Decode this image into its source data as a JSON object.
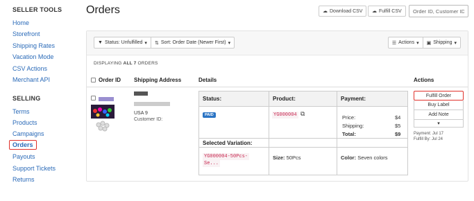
{
  "sidebar": {
    "seller_tools_heading": "SELLER TOOLS",
    "seller_tools": [
      "Home",
      "Storefront",
      "Shipping Rates",
      "Vacation Mode",
      "CSV Actions",
      "Merchant API"
    ],
    "selling_heading": "SELLING",
    "selling": [
      "Terms",
      "Products",
      "Campaigns",
      "Orders",
      "Payouts",
      "Support Tickets",
      "Returns"
    ],
    "active_item": "Orders"
  },
  "header": {
    "title": "Orders",
    "download_csv": "Download CSV",
    "fulfill_csv": "Fulfill CSV",
    "search_placeholder": "Order ID, Customer ID"
  },
  "toolbar": {
    "status_filter": "Status: Unfulfilled",
    "sort": "Sort: Order Date (Newer First)",
    "actions": "Actions",
    "shipping": "Shipping"
  },
  "count": {
    "prefix": "DISPLAYING",
    "bold": "ALL 7",
    "suffix": "ORDERS"
  },
  "table": {
    "headers": [
      "Order ID",
      "Shipping Address",
      "Details",
      "Actions"
    ]
  },
  "order": {
    "address_line": "USA 9",
    "customer_id_label": "Customer ID:",
    "details": {
      "status_header": "Status:",
      "product_header": "Product:",
      "payment_header": "Payment:",
      "status_badge": "PAID",
      "product_sku": "YG000004",
      "price_label": "Price:",
      "price_value": "$4",
      "shipping_label": "Shipping:",
      "shipping_value": "$5",
      "total_label": "Total:",
      "total_value": "$9",
      "selected_variation_header": "Selected Variation:",
      "variation_sku_line1": "YG000004-50Pcs-",
      "variation_sku_line2": "Se...",
      "size_label": "Size:",
      "size_value": "50Pcs",
      "color_label": "Color:",
      "color_value": "Seven colors"
    },
    "actions": {
      "fulfill": "Fulfill Order",
      "buy_label": "Buy Label",
      "add_note": "Add Note",
      "more": "▾",
      "payment_date": "Payment: Jul 17",
      "fulfill_by": "Fulfill By: Jul 24"
    }
  },
  "colors": {
    "link": "#2a6ab8",
    "highlight": "#e0302a",
    "badge": "#2b74c4",
    "sku": "#c7254e"
  }
}
